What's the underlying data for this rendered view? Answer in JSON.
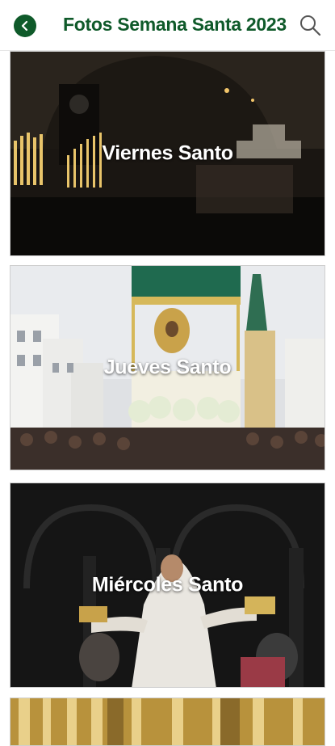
{
  "header": {
    "title": "Fotos Semana Santa 2023",
    "back_icon": "chevron-left-icon",
    "search_icon": "search-icon",
    "accent_color": "#0f5a2a"
  },
  "gallery": {
    "items": [
      {
        "label": "Viernes Santo"
      },
      {
        "label": "Jueves Santo"
      },
      {
        "label": "Miércoles Santo"
      },
      {
        "label": ""
      }
    ]
  }
}
